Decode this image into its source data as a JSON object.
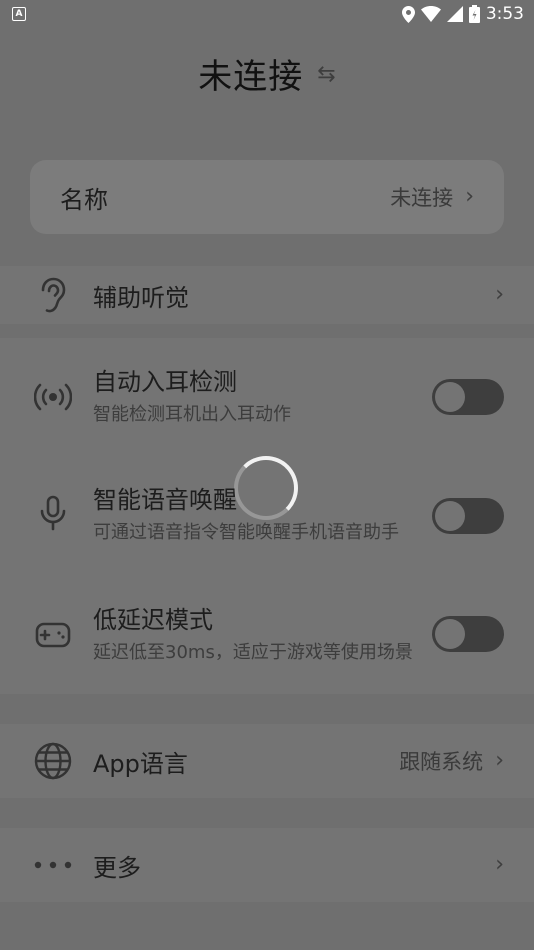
{
  "status_bar": {
    "time": "3:53",
    "app_badge": "A"
  },
  "header": {
    "title": "未连接"
  },
  "name_card": {
    "label": "名称",
    "value": "未连接"
  },
  "hearing": {
    "label": "辅助听觉"
  },
  "settings": {
    "auto_ear": {
      "title": "自动入耳检测",
      "subtitle": "智能检测耳机出入耳动作",
      "enabled": false
    },
    "voice_wake": {
      "title": "智能语音唤醒",
      "subtitle": "可通过语音指令智能唤醒手机语音助手",
      "enabled": false
    },
    "low_latency": {
      "title": "低延迟模式",
      "subtitle": "延迟低至30ms，适应于游戏等使用场景",
      "enabled": false
    }
  },
  "language": {
    "label": "App语言",
    "value": "跟随系统"
  },
  "more": {
    "label": "更多"
  },
  "colors": {
    "overlay_bg": "#6f6f6f",
    "card_bg": "#7c7c7c",
    "toggle_off": "#3e3e3e"
  }
}
